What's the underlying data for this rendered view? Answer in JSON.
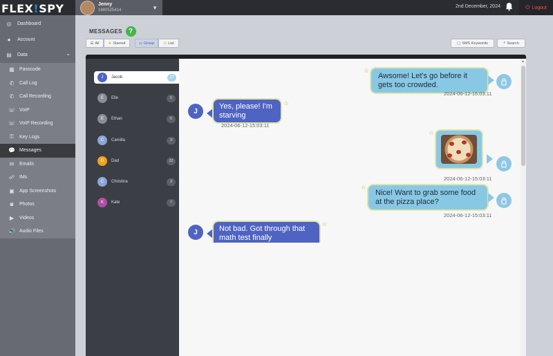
{
  "brand": {
    "left": "FLEX",
    "bang": "!",
    "right": "SPY"
  },
  "profile": {
    "name": "Jenny",
    "phone": "1880525414"
  },
  "header": {
    "date": "2nd December, 2024",
    "logout": "Logout"
  },
  "sidebar": {
    "items": [
      {
        "label": "Dashboard",
        "icon": "dashboard-icon"
      },
      {
        "label": "Account",
        "icon": "user-icon"
      },
      {
        "label": "Data",
        "icon": "database-icon"
      }
    ],
    "subitems": [
      {
        "label": "Passcode",
        "icon": "grid-icon"
      },
      {
        "label": "Call Log",
        "icon": "phone-icon"
      },
      {
        "label": "Call Recording",
        "icon": "phone-recording-icon"
      },
      {
        "label": "VoIP",
        "icon": "voip-icon"
      },
      {
        "label": "VoIP Recording",
        "icon": "voip-recording-icon"
      },
      {
        "label": "Key Logs",
        "icon": "key-icon"
      },
      {
        "label": "Messages",
        "icon": "chat-icon"
      },
      {
        "label": "Emails",
        "icon": "email-icon"
      },
      {
        "label": "IMs",
        "icon": "im-icon"
      },
      {
        "label": "App Screenshots",
        "icon": "screenshot-icon"
      },
      {
        "label": "Photos",
        "icon": "camera-icon"
      },
      {
        "label": "Videos",
        "icon": "video-icon"
      },
      {
        "label": "Audio Files",
        "icon": "audio-icon"
      }
    ]
  },
  "page": {
    "title": "MESSAGES",
    "help": "?"
  },
  "toolbar": {
    "all": "All",
    "starred": "Starred",
    "group": "Group",
    "list": "List",
    "keywords": "SMS Keywords",
    "search": "Search"
  },
  "contacts": [
    {
      "initial": "J",
      "name": "Jacob",
      "count": "17",
      "color": "#4f63c2"
    },
    {
      "initial": "E",
      "name": "Elle",
      "count": "5",
      "color": "#8a8d94"
    },
    {
      "initial": "E",
      "name": "Ethan",
      "count": "5",
      "color": "#8a8d94"
    },
    {
      "initial": "C",
      "name": "Camilla",
      "count": "3",
      "color": "#8aa6d8"
    },
    {
      "initial": "D",
      "name": "Dad",
      "count": "22",
      "color": "#f0a31c"
    },
    {
      "initial": "C",
      "name": "Christina",
      "count": "3",
      "color": "#8aa6d8"
    },
    {
      "initial": "K",
      "name": "Kate",
      "count": "7",
      "color": "#b14ea0"
    }
  ],
  "messages": {
    "m1": {
      "text": "Awsome! Let's go before it gets too crowded.",
      "time": "2024-06-12-15:03:11"
    },
    "m2": {
      "text": "Yes, please! I'm starving",
      "time": "2024-06-12-15:03:11",
      "initial": "J"
    },
    "m3": {
      "time": "2024-06-12-15:03:11"
    },
    "m4": {
      "text": "Nice! Want to grab some food at the pizza place?",
      "time": "2024-06-12-15:03:11"
    },
    "m5": {
      "text": "Not bad. Got through that math test finally",
      "initial": "J"
    }
  }
}
